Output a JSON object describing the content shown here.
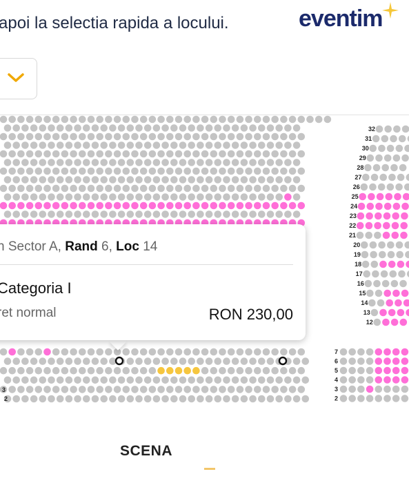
{
  "header": {
    "instruction": "apoi la selectia rapida a locului.",
    "logo": "eventim"
  },
  "dropdown": {
    "icon": "chevron-down-icon"
  },
  "popup": {
    "location_prefix": "n Sector A,",
    "rand_label": "Rand",
    "rand_value": "6,",
    "loc_label": "Loc",
    "loc_value": "14",
    "category": "Categoria I",
    "ticket_type": "ret normal",
    "price": "RON 230,00"
  },
  "stage": {
    "label": "SCENA"
  },
  "right_section": {
    "row_labels_top": [
      "32",
      "31",
      "30",
      "29",
      "28",
      "27",
      "26",
      "25",
      "24",
      "23",
      "22",
      "21",
      "20",
      "19",
      "18",
      "17",
      "16",
      "15",
      "14",
      "13",
      "12"
    ],
    "row_labels_bottom": [
      "7",
      "6",
      "5",
      "4",
      "3",
      "2"
    ]
  },
  "left_row_labels": [
    "3",
    "2"
  ],
  "colors": {
    "available_pink": "#ff6fd8",
    "unavailable_grey": "#c4c4c4",
    "selected_yellow": "#f6c63f",
    "accent_orange": "#f0a800",
    "logo_navy": "#1b2a6b"
  }
}
